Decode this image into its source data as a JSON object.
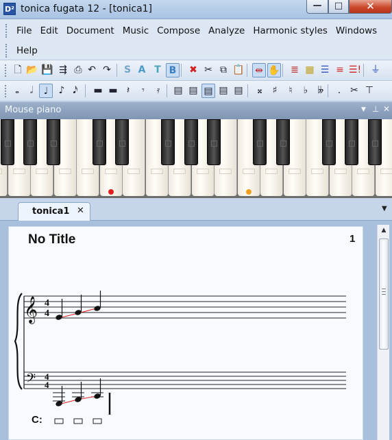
{
  "window": {
    "title": "tonica fugata 12 - [tonica1]",
    "app_icon": "D²"
  },
  "window_controls": {
    "minimize": "—",
    "maximize": "□",
    "close": "✕"
  },
  "menu": {
    "row1": [
      "File",
      "Edit",
      "Document",
      "Music",
      "Compose",
      "Analyze",
      "Harmonic styles",
      "Windows"
    ],
    "row2": [
      "Help"
    ]
  },
  "toolbar1": {
    "buttons": [
      {
        "name": "new-document-icon",
        "glyph": "🗋"
      },
      {
        "name": "open-folder-icon",
        "glyph": "📂"
      },
      {
        "name": "save-icon",
        "glyph": "💾"
      },
      {
        "name": "export-icon",
        "glyph": "⇶"
      },
      {
        "name": "print-icon",
        "glyph": "⎙"
      },
      {
        "name": "undo-icon",
        "glyph": "↶"
      },
      {
        "name": "redo-icon",
        "glyph": "↷"
      },
      {
        "name": "voice-soprano-button",
        "glyph": "S",
        "color": "#6fa6c8"
      },
      {
        "name": "voice-alto-button",
        "glyph": "A",
        "color": "#4a9ac9"
      },
      {
        "name": "voice-tenor-button",
        "glyph": "T",
        "color": "#4aa6b8"
      },
      {
        "name": "voice-bass-button",
        "glyph": "B",
        "color": "#3a7fc0"
      },
      {
        "name": "delete-icon",
        "glyph": "✖",
        "color": "#d02020"
      },
      {
        "name": "cut-icon",
        "glyph": "✂"
      },
      {
        "name": "copy-icon",
        "glyph": "⧉"
      },
      {
        "name": "paste-icon",
        "glyph": "📋"
      },
      {
        "name": "range-icon",
        "glyph": "⇹",
        "color": "#c03030"
      },
      {
        "name": "hand-tool-icon",
        "glyph": "✋"
      },
      {
        "name": "list-red-icon",
        "glyph": "≣",
        "color": "#c03030"
      },
      {
        "name": "grid-colors-icon",
        "glyph": "▦",
        "color": "#c0a020"
      },
      {
        "name": "align-colors-icon",
        "glyph": "☰",
        "color": "#3050c0"
      },
      {
        "name": "list-colored-icon",
        "glyph": "≡",
        "color": "#d03030"
      },
      {
        "name": "list-alert-icon",
        "glyph": "☰!",
        "color": "#d02020"
      },
      {
        "name": "filter-icon",
        "glyph": "⏚",
        "color": "#2a4fc0"
      }
    ]
  },
  "toolbar2": {
    "buttons": [
      {
        "name": "whole-note-icon",
        "glyph": "𝅝"
      },
      {
        "name": "half-note-icon",
        "glyph": "𝅗𝅥"
      },
      {
        "name": "quarter-note-icon",
        "glyph": "♩"
      },
      {
        "name": "eighth-note-icon",
        "glyph": "♪"
      },
      {
        "name": "sixteenth-note-icon",
        "glyph": "𝅘𝅥𝅯"
      },
      {
        "name": "whole-rest-icon",
        "glyph": "▬"
      },
      {
        "name": "half-rest-icon",
        "glyph": "▬"
      },
      {
        "name": "quarter-rest-icon",
        "glyph": "𝄽"
      },
      {
        "name": "eighth-rest-icon",
        "glyph": "𝄾"
      },
      {
        "name": "sixteenth-rest-icon",
        "glyph": "𝄿"
      },
      {
        "name": "staff-style-1-icon",
        "glyph": "▤"
      },
      {
        "name": "staff-style-2-icon",
        "glyph": "▤"
      },
      {
        "name": "staff-style-3-icon",
        "glyph": "▤"
      },
      {
        "name": "staff-style-4-icon",
        "glyph": "▤"
      },
      {
        "name": "staff-style-5-icon",
        "glyph": "▤"
      },
      {
        "name": "double-sharp-icon",
        "glyph": "𝄪"
      },
      {
        "name": "sharp-icon",
        "glyph": "♯"
      },
      {
        "name": "natural-icon",
        "glyph": "♮"
      },
      {
        "name": "flat-icon",
        "glyph": "♭"
      },
      {
        "name": "double-flat-icon",
        "glyph": "𝄫"
      },
      {
        "name": "dot-icon",
        "glyph": "."
      },
      {
        "name": "scissor-tie-icon",
        "glyph": "✂"
      },
      {
        "name": "tie-icon",
        "glyph": "⊤"
      }
    ]
  },
  "mouse_piano": {
    "title": "Mouse piano",
    "controls": {
      "dropdown": "▼",
      "pin": "⊥",
      "close": "✕"
    },
    "marked_keys": [
      {
        "white_key_index": 5,
        "color": "#e02020"
      },
      {
        "white_key_index": 11,
        "color": "#f0a020"
      }
    ]
  },
  "document_tab": {
    "label": "tonica1",
    "close": "✕",
    "dropdown": "▼"
  },
  "score": {
    "title": "No Title",
    "page_number": "1",
    "time_signature": {
      "numerator": "4",
      "denominator": "4"
    },
    "chord_symbol": "C:"
  },
  "colors": {
    "accent": "#6d96c6",
    "voice_line": "#e02020",
    "page_bg": "#f7fbff"
  }
}
